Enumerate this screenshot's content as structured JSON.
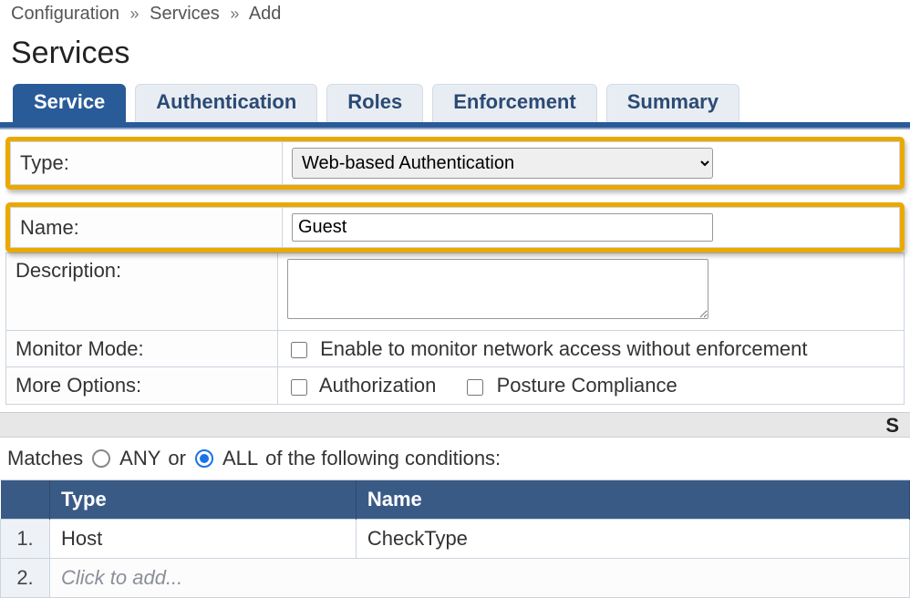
{
  "breadcrumb": {
    "items": [
      "Configuration",
      "Services",
      "Add"
    ],
    "sep": "»"
  },
  "title": "Services",
  "tabs": [
    {
      "id": "service",
      "label": "Service",
      "active": true
    },
    {
      "id": "authentication",
      "label": "Authentication",
      "active": false
    },
    {
      "id": "roles",
      "label": "Roles",
      "active": false
    },
    {
      "id": "enforcement",
      "label": "Enforcement",
      "active": false
    },
    {
      "id": "summary",
      "label": "Summary",
      "active": false
    }
  ],
  "form": {
    "type_label": "Type:",
    "type_value": "Web-based Authentication",
    "name_label": "Name:",
    "name_value": "Guest",
    "description_label": "Description:",
    "description_value": "",
    "monitor_label": "Monitor Mode:",
    "monitor_cb_label": "Enable to monitor network access without enforcement",
    "more_options_label": "More Options:",
    "more_options": {
      "authorization_label": "Authorization",
      "posture_label": "Posture Compliance"
    }
  },
  "grey_strip_right": "S",
  "matches": {
    "prefix": "Matches",
    "any": "ANY",
    "or": "or",
    "all": "ALL",
    "suffix": "of the following conditions:",
    "selected": "all"
  },
  "cond_headers": {
    "type": "Type",
    "name": "Name"
  },
  "conditions": [
    {
      "num": "1.",
      "type": "Host",
      "name": "CheckType"
    }
  ],
  "add_row": {
    "num": "2.",
    "text": "Click to add..."
  }
}
